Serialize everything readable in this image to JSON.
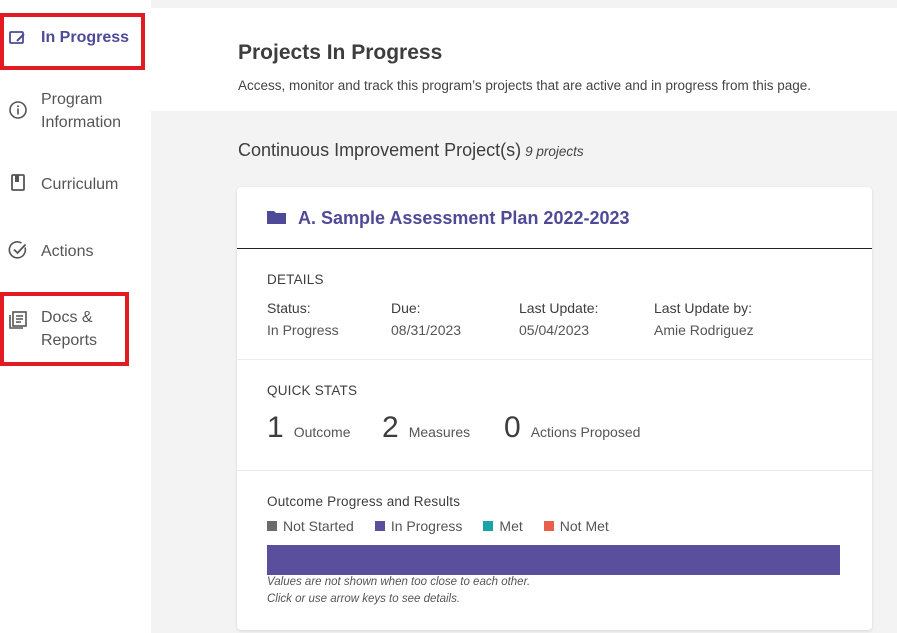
{
  "sidebar": {
    "items": [
      {
        "label": "In Progress"
      },
      {
        "label": "Program Information"
      },
      {
        "label": "Curriculum"
      },
      {
        "label": "Actions"
      },
      {
        "label": "Docs & Reports"
      }
    ]
  },
  "header": {
    "title": "Projects In Progress",
    "subtitle": "Access, monitor and track this program’s projects that are active and in progress from this page."
  },
  "section": {
    "title": "Continuous Improvement Project(s)",
    "count": "9 projects"
  },
  "project": {
    "title": "A. Sample Assessment Plan 2022-2023",
    "details_label": "DETAILS",
    "status_label": "Status:",
    "status_value": "In Progress",
    "due_label": "Due:",
    "due_value": "08/31/2023",
    "last_update_label": "Last Update:",
    "last_update_value": "05/04/2023",
    "last_update_by_label": "Last Update by:",
    "last_update_by_value": "Amie Rodriguez",
    "quick_stats_label": "QUICK STATS",
    "stats": [
      {
        "num": "1",
        "label": "Outcome"
      },
      {
        "num": "2",
        "label": "Measures"
      },
      {
        "num": "0",
        "label": "Actions Proposed"
      }
    ],
    "progress_title": "Outcome Progress and Results",
    "legend": [
      {
        "label": "Not Started",
        "color": "#6b6b6b"
      },
      {
        "label": "In Progress",
        "color": "#5a4f9c"
      },
      {
        "label": "Met",
        "color": "#1aa3a7"
      },
      {
        "label": "Not Met",
        "color": "#e8604c"
      }
    ],
    "progress_in_progress_fraction": 1.0,
    "progress_color": "#5a4f9c",
    "note_line1": "Values are not shown when too close to each other.",
    "note_line2": "Click or use arrow keys to see details."
  },
  "colors": {
    "accent": "#4f4a98",
    "highlight": "#e21b22"
  }
}
